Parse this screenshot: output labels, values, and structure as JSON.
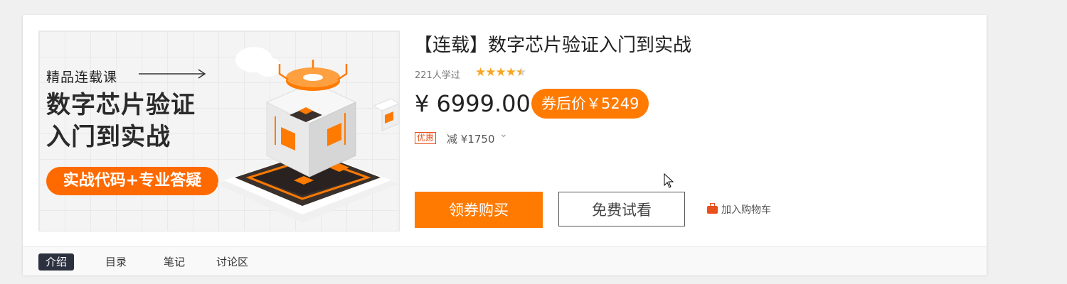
{
  "course": {
    "title": "【连载】数字芯片验证入门到实战",
    "learners": "221人学过",
    "rating": 4.5,
    "price": "¥ 6999.00",
    "coupon_price": "券后价￥5249",
    "discount_tag": "优惠",
    "discount_text": "减 ¥1750"
  },
  "cover": {
    "tag": "精品连载课",
    "title_line1": "数字芯片验证",
    "title_line2": "入门到实战",
    "pill": "实战代码+专业答疑"
  },
  "actions": {
    "buy": "领券购买",
    "trial": "免费试看",
    "cart": "加入购物车"
  },
  "tabs": [
    {
      "label": "介绍",
      "active": true
    },
    {
      "label": "目录",
      "active": false
    },
    {
      "label": "笔记",
      "active": false
    },
    {
      "label": "讨论区",
      "active": false
    }
  ],
  "colors": {
    "accent": "#ff7a00",
    "tab_active_bg": "#2c3140",
    "discount": "#e8501c",
    "star": "#f5a623"
  }
}
